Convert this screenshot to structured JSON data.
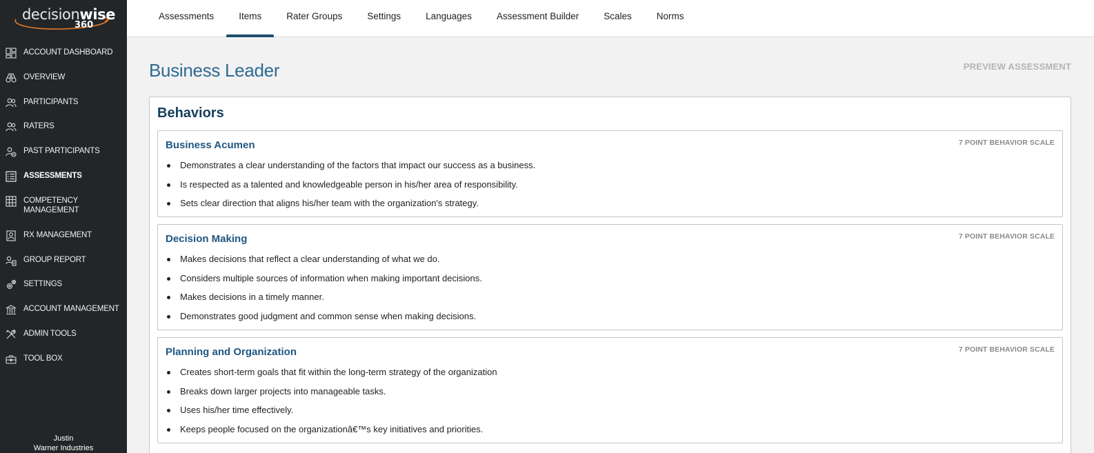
{
  "logo": {
    "light": "decision",
    "bold": "wise",
    "num": "360"
  },
  "sidebar": {
    "items": [
      {
        "label": "ACCOUNT DASHBOARD",
        "icon": "dashboard-icon"
      },
      {
        "label": "OVERVIEW",
        "icon": "binoculars-icon"
      },
      {
        "label": "PARTICIPANTS",
        "icon": "users-icon"
      },
      {
        "label": "RATERS",
        "icon": "raters-icon"
      },
      {
        "label": "PAST PARTICIPANTS",
        "icon": "past-participants-icon"
      },
      {
        "label": "ASSESSMENTS",
        "icon": "checklist-icon",
        "active": true
      },
      {
        "label": "COMPETENCY MANAGEMENT",
        "icon": "grid-icon"
      },
      {
        "label": "RX MANAGEMENT",
        "icon": "rx-icon"
      },
      {
        "label": "GROUP REPORT",
        "icon": "group-report-icon"
      },
      {
        "label": "SETTINGS",
        "icon": "gears-icon"
      },
      {
        "label": "ACCOUNT MANAGEMENT",
        "icon": "building-icon"
      },
      {
        "label": "ADMIN TOOLS",
        "icon": "tools-icon"
      },
      {
        "label": "TOOL BOX",
        "icon": "toolbox-icon"
      }
    ]
  },
  "user": {
    "name": "Justin",
    "company": "Warner Industries"
  },
  "topnav": {
    "tabs": [
      {
        "label": "Assessments"
      },
      {
        "label": "Items",
        "active": true
      },
      {
        "label": "Rater Groups"
      },
      {
        "label": "Settings"
      },
      {
        "label": "Languages"
      },
      {
        "label": "Assessment Builder"
      },
      {
        "label": "Scales"
      },
      {
        "label": "Norms"
      }
    ]
  },
  "page": {
    "title": "Business Leader",
    "preview_label": "PREVIEW ASSESSMENT",
    "section_heading": "Behaviors"
  },
  "competencies": [
    {
      "title": "Business Acumen",
      "scale": "7 POINT BEHAVIOR SCALE",
      "items": [
        "Demonstrates a clear understanding of the factors that impact our success as a business.",
        "Is respected as a talented and knowledgeable person in his/her area of responsibility.",
        "Sets clear direction that aligns his/her team with the organization's strategy."
      ]
    },
    {
      "title": "Decision Making",
      "scale": "7 POINT BEHAVIOR SCALE",
      "items": [
        "Makes decisions that reflect a clear understanding of what we do.",
        "Considers multiple sources of information when making important decisions.",
        "Makes decisions in a timely manner.",
        "Demonstrates good judgment and common sense when making decisions."
      ]
    },
    {
      "title": "Planning and Organization",
      "scale": "7 POINT BEHAVIOR SCALE",
      "items": [
        "Creates short-term goals that fit within the long-term strategy of the organization",
        "Breaks down larger projects into manageable tasks.",
        "Uses his/her time effectively.",
        "Keeps people focused on the organizationâ€™s key initiatives and priorities."
      ]
    }
  ],
  "colors": {
    "sidebar_bg": "#232628",
    "accent": "#1d4d6e",
    "title": "#2d6a92",
    "heading": "#153e5c",
    "comp_title": "#1f5782"
  }
}
